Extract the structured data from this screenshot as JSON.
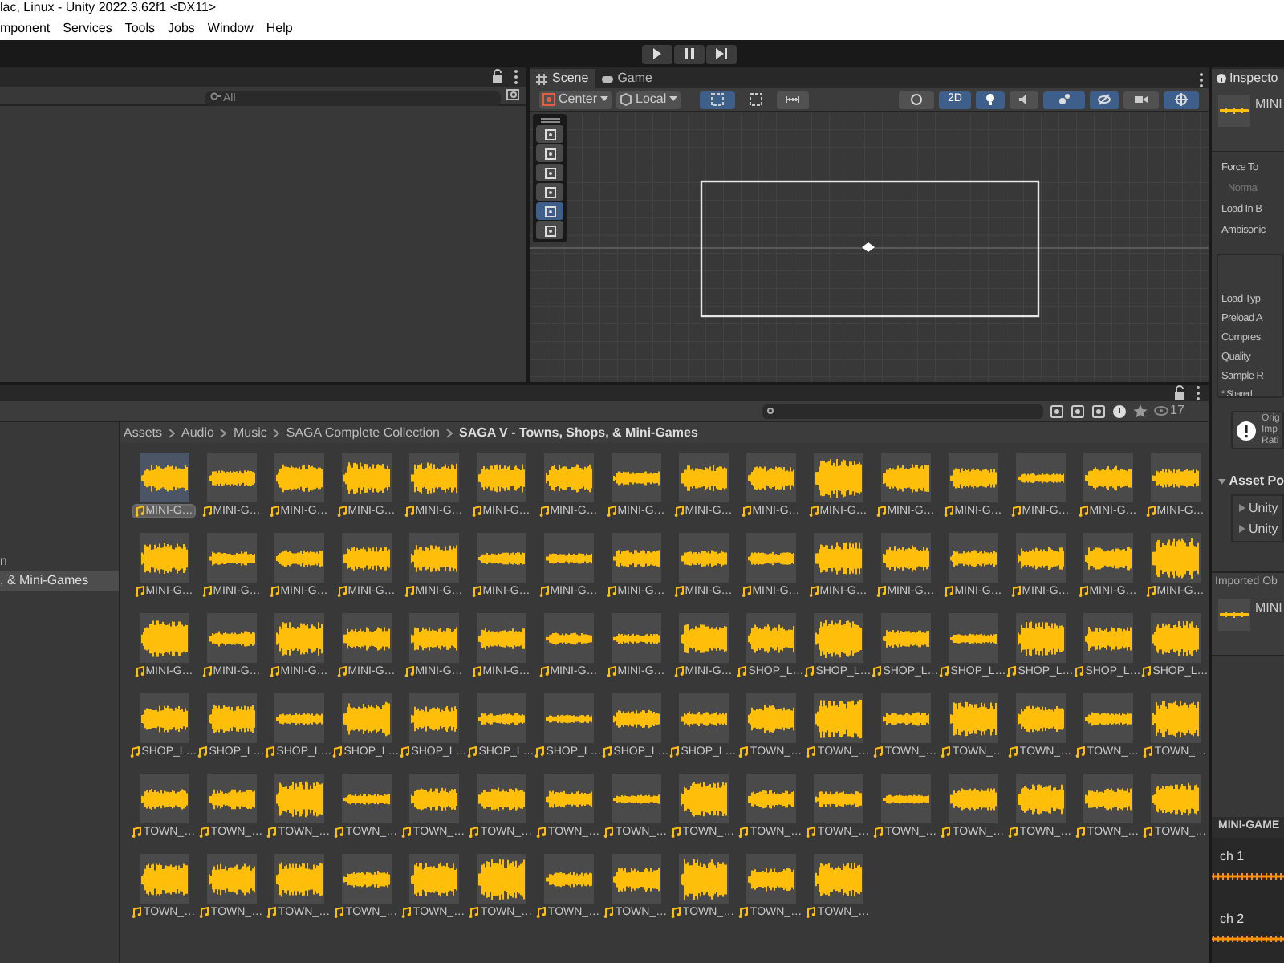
{
  "title_bar": {
    "title": "lac, Linux - Unity 2022.3.62f1 <DX11>"
  },
  "menu": [
    "mponent",
    "Services",
    "Tools",
    "Jobs",
    "Window",
    "Help"
  ],
  "hierarchy": {
    "search": {
      "placeholder": "All"
    }
  },
  "scene": {
    "tabs": [
      {
        "label": "Scene",
        "selected": true
      },
      {
        "label": "Game",
        "selected": false
      }
    ],
    "pivot": "Center",
    "space": "Local",
    "toggle_2d": {
      "label": "2D",
      "on": true
    }
  },
  "project": {
    "folders": [
      {
        "label": "n",
        "selected": false
      },
      {
        "label": ", & Mini-Games",
        "selected": true
      }
    ],
    "breadcrumb": [
      "Assets",
      "Audio",
      "Music",
      "SAGA Complete Collection",
      "SAGA V - Towns, Shops, & Mini-Games"
    ],
    "count": "17",
    "assets": [
      {
        "label": "MINI-G…",
        "selected": true
      },
      {
        "label": "MINI-G…",
        "selected": false
      },
      {
        "label": "MINI-G…",
        "selected": false
      },
      {
        "label": "MINI-G…",
        "selected": false
      },
      {
        "label": "MINI-G…",
        "selected": false
      },
      {
        "label": "MINI-G…",
        "selected": false
      },
      {
        "label": "MINI-G…",
        "selected": false
      },
      {
        "label": "MINI-G…",
        "selected": false
      },
      {
        "label": "MINI-G…",
        "selected": false
      },
      {
        "label": "MINI-G…",
        "selected": false
      },
      {
        "label": "MINI-G…",
        "selected": false
      },
      {
        "label": "MINI-G…",
        "selected": false
      },
      {
        "label": "MINI-G…",
        "selected": false
      },
      {
        "label": "MINI-G…",
        "selected": false
      },
      {
        "label": "MINI-G…",
        "selected": false
      },
      {
        "label": "MINI-G…",
        "selected": false
      },
      {
        "label": "MINI-G…",
        "selected": false
      },
      {
        "label": "MINI-G…",
        "selected": false
      },
      {
        "label": "MINI-G…",
        "selected": false
      },
      {
        "label": "MINI-G…",
        "selected": false
      },
      {
        "label": "MINI-G…",
        "selected": false
      },
      {
        "label": "MINI-G…",
        "selected": false
      },
      {
        "label": "MINI-G…",
        "selected": false
      },
      {
        "label": "MINI-G…",
        "selected": false
      },
      {
        "label": "MINI-G…",
        "selected": false
      },
      {
        "label": "MINI-G…",
        "selected": false
      },
      {
        "label": "MINI-G…",
        "selected": false
      },
      {
        "label": "MINI-G…",
        "selected": false
      },
      {
        "label": "MINI-G…",
        "selected": false
      },
      {
        "label": "MINI-G…",
        "selected": false
      },
      {
        "label": "MINI-G…",
        "selected": false
      },
      {
        "label": "MINI-G…",
        "selected": false
      },
      {
        "label": "MINI-G…",
        "selected": false
      },
      {
        "label": "MINI-G…",
        "selected": false
      },
      {
        "label": "MINI-G…",
        "selected": false
      },
      {
        "label": "MINI-G…",
        "selected": false
      },
      {
        "label": "MINI-G…",
        "selected": false
      },
      {
        "label": "MINI-G…",
        "selected": false
      },
      {
        "label": "MINI-G…",
        "selected": false
      },
      {
        "label": "MINI-G…",
        "selected": false
      },
      {
        "label": "MINI-G…",
        "selected": false
      },
      {
        "label": "SHOP_L…",
        "selected": false
      },
      {
        "label": "SHOP_L…",
        "selected": false
      },
      {
        "label": "SHOP_L…",
        "selected": false
      },
      {
        "label": "SHOP_L…",
        "selected": false
      },
      {
        "label": "SHOP_L…",
        "selected": false
      },
      {
        "label": "SHOP_L…",
        "selected": false
      },
      {
        "label": "SHOP_L…",
        "selected": false
      },
      {
        "label": "SHOP_L…",
        "selected": false
      },
      {
        "label": "SHOP_L…",
        "selected": false
      },
      {
        "label": "SHOP_L…",
        "selected": false
      },
      {
        "label": "SHOP_L…",
        "selected": false
      },
      {
        "label": "SHOP_L…",
        "selected": false
      },
      {
        "label": "SHOP_L…",
        "selected": false
      },
      {
        "label": "SHOP_L…",
        "selected": false
      },
      {
        "label": "SHOP_L…",
        "selected": false
      },
      {
        "label": "SHOP_L…",
        "selected": false
      },
      {
        "label": "TOWN_…",
        "selected": false
      },
      {
        "label": "TOWN_…",
        "selected": false
      },
      {
        "label": "TOWN_…",
        "selected": false
      },
      {
        "label": "TOWN_…",
        "selected": false
      },
      {
        "label": "TOWN_…",
        "selected": false
      },
      {
        "label": "TOWN_…",
        "selected": false
      },
      {
        "label": "TOWN_…",
        "selected": false
      },
      {
        "label": "TOWN_…",
        "selected": false
      },
      {
        "label": "TOWN_…",
        "selected": false
      },
      {
        "label": "TOWN_…",
        "selected": false
      },
      {
        "label": "TOWN_…",
        "selected": false
      },
      {
        "label": "TOWN_…",
        "selected": false
      },
      {
        "label": "TOWN_…",
        "selected": false
      },
      {
        "label": "TOWN_…",
        "selected": false
      },
      {
        "label": "TOWN_…",
        "selected": false
      },
      {
        "label": "TOWN_…",
        "selected": false
      },
      {
        "label": "TOWN_…",
        "selected": false
      },
      {
        "label": "TOWN_…",
        "selected": false
      },
      {
        "label": "TOWN_…",
        "selected": false
      },
      {
        "label": "TOWN_…",
        "selected": false
      },
      {
        "label": "TOWN_…",
        "selected": false
      },
      {
        "label": "TOWN_…",
        "selected": false
      },
      {
        "label": "TOWN_…",
        "selected": false
      },
      {
        "label": "TOWN_…",
        "selected": false
      },
      {
        "label": "TOWN_…",
        "selected": false
      },
      {
        "label": "TOWN_…",
        "selected": false
      },
      {
        "label": "TOWN_…",
        "selected": false
      },
      {
        "label": "TOWN_…",
        "selected": false
      },
      {
        "label": "TOWN_…",
        "selected": false
      },
      {
        "label": "TOWN_…",
        "selected": false
      },
      {
        "label": "TOWN_…",
        "selected": false
      },
      {
        "label": "TOWN_…",
        "selected": false
      },
      {
        "label": "TOWN_…",
        "selected": false
      },
      {
        "label": "TOWN_…",
        "selected": false
      }
    ]
  },
  "inspector": {
    "tab": "Inspecto",
    "asset_name": "MINI",
    "fields": [
      "Force To",
      "Normal",
      "Load In B",
      "Ambisonic"
    ],
    "settings": [
      "Load Typ",
      "Preload A",
      "Compres",
      "Quality",
      "Sample R",
      "* Shared"
    ],
    "warning": [
      "Orig",
      "Imp",
      "Rati"
    ],
    "asset_postprocessors": {
      "title": "Asset Po",
      "items": [
        "Unity",
        "Unity"
      ]
    },
    "imported_title": "Imported Ob",
    "imported_name": "MINI",
    "preview_title": "MINI-GAME",
    "channels": [
      "ch 1",
      "ch 2"
    ]
  }
}
